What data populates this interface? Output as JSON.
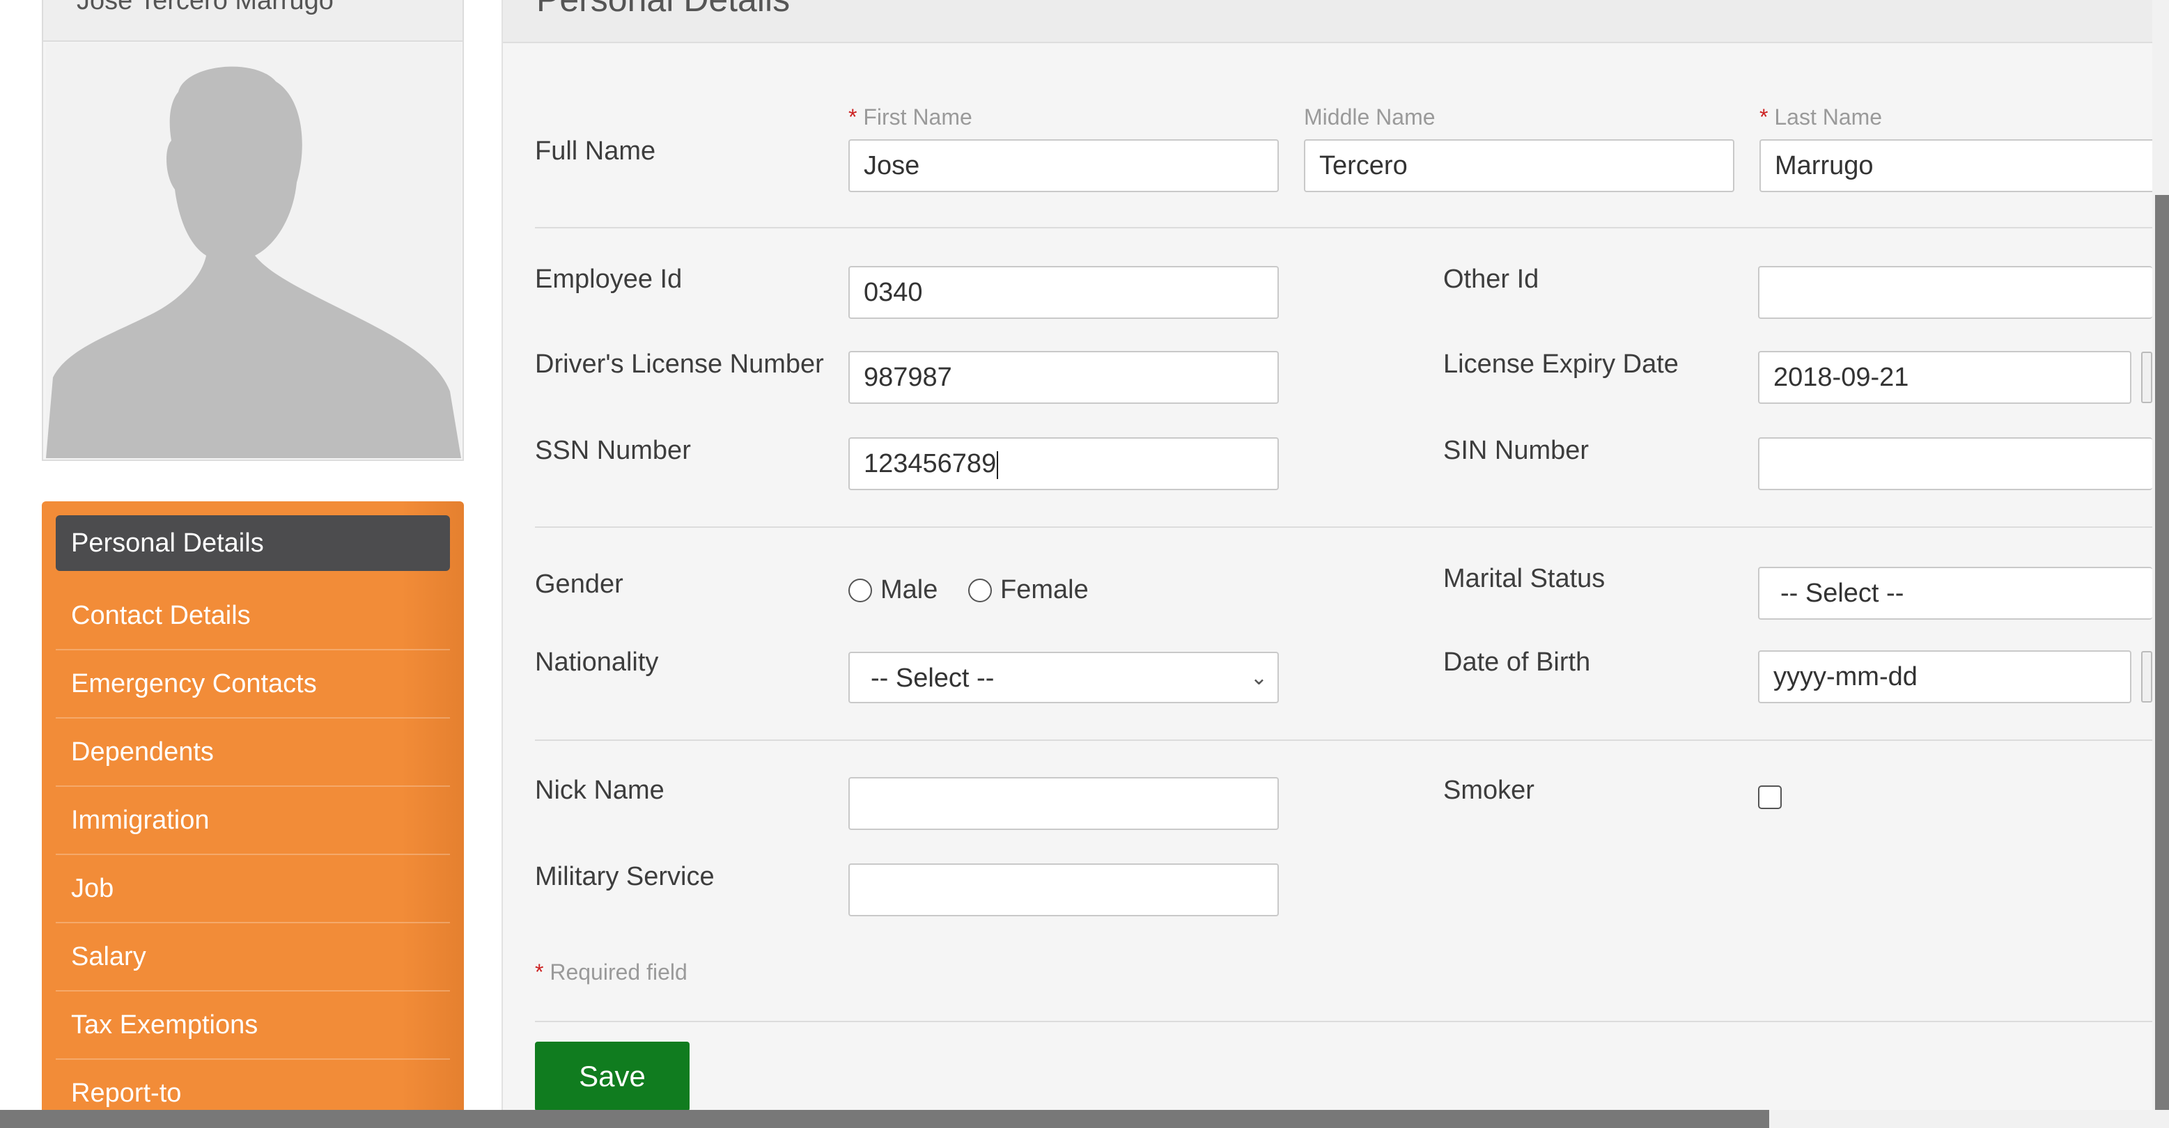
{
  "profile": {
    "name": "Jose Tercero Marrugo"
  },
  "menu": {
    "items": [
      {
        "label": "Personal Details"
      },
      {
        "label": "Contact Details"
      },
      {
        "label": "Emergency Contacts"
      },
      {
        "label": "Dependents"
      },
      {
        "label": "Immigration"
      },
      {
        "label": "Job"
      },
      {
        "label": "Salary"
      },
      {
        "label": "Tax Exemptions"
      },
      {
        "label": "Report-to"
      }
    ]
  },
  "panel": {
    "title": "Personal Details"
  },
  "form": {
    "full_name_label": "Full Name",
    "first_name_label": "First Name",
    "middle_name_label": "Middle Name",
    "last_name_label": "Last Name",
    "required_star": "*",
    "first_name": "Jose",
    "middle_name": "Tercero",
    "last_name": "Marrugo",
    "employee_id_label": "Employee Id",
    "employee_id": "0340",
    "other_id_label": "Other Id",
    "other_id": "",
    "drivers_license_label": "Driver's License Number",
    "drivers_license": "987987",
    "license_expiry_label": "License Expiry Date",
    "license_expiry": "2018-09-21",
    "ssn_label": "SSN Number",
    "ssn": "123456789",
    "sin_label": "SIN Number",
    "sin": "",
    "gender_label": "Gender",
    "gender_options": [
      "Male",
      "Female"
    ],
    "marital_status_label": "Marital Status",
    "marital_status": "-- Select --",
    "nationality_label": "Nationality",
    "nationality": "-- Select --",
    "dob_label": "Date of Birth",
    "dob_placeholder": "yyyy-mm-dd",
    "nick_name_label": "Nick Name",
    "nick_name": "",
    "smoker_label": "Smoker",
    "military_label": "Military Service",
    "military": "",
    "required_note": "Required field",
    "save_label": "Save"
  }
}
